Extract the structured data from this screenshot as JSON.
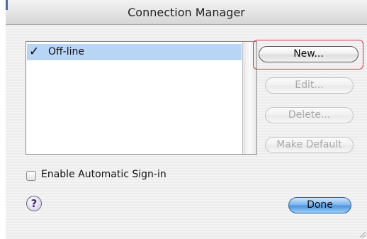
{
  "window": {
    "title": "Connection Manager"
  },
  "connections": [
    {
      "label": "Off-line",
      "checked": true,
      "selected": true
    }
  ],
  "buttons": {
    "new": "New...",
    "edit": "Edit...",
    "delete": "Delete...",
    "make_default": "Make Default",
    "done": "Done"
  },
  "options": {
    "auto_signin_label": "Enable Automatic Sign-in",
    "auto_signin_checked": false
  },
  "help": {
    "glyph": "?"
  },
  "colors": {
    "selection": "#b8d5f5",
    "highlight_border": "#d9313f",
    "default_button": "#4f94dd"
  }
}
